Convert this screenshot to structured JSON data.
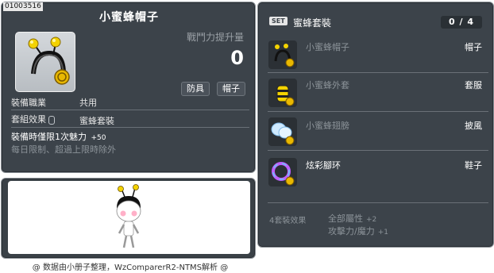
{
  "item": {
    "code": "01003516",
    "name": "小蜜蜂帽子",
    "power_label": "戰鬥力提升量",
    "power_value": "0",
    "tags": [
      "防具",
      "帽子"
    ],
    "job_label": "裝備職業",
    "job_value": "共用",
    "set_label": "套組效果",
    "set_value": "蜜蜂套裝",
    "charm_text": "裝備時僅限1次魅力",
    "charm_value": "+50",
    "limit_text": "每日限制、超過上限時除外"
  },
  "set": {
    "badge": "SET",
    "title": "蜜蜂套裝",
    "count": "0 / 4",
    "items": [
      {
        "name": "小蜜蜂帽子",
        "slot": "帽子",
        "icon": "bee-hat-icon"
      },
      {
        "name": "小蜜蜂外套",
        "slot": "套服",
        "icon": "bee-suit-icon"
      },
      {
        "name": "小蜜蜂翅膀",
        "slot": "披風",
        "icon": "bee-wings-icon"
      },
      {
        "name": "炫彩腳环",
        "slot": "鞋子",
        "icon": "rainbow-ring-icon"
      }
    ],
    "effect_label": "4套裝效果",
    "effects": [
      {
        "name": "全部屬性",
        "value": "+2"
      },
      {
        "name": "攻擊力/魔力",
        "value": "+1"
      }
    ]
  },
  "footer": "@ 数据由小册子整理，WzComparerR2-NTMS解析 @",
  "colors": {
    "panel": "#3c434a",
    "border": "#8a9096",
    "muted": "#8c9399"
  }
}
